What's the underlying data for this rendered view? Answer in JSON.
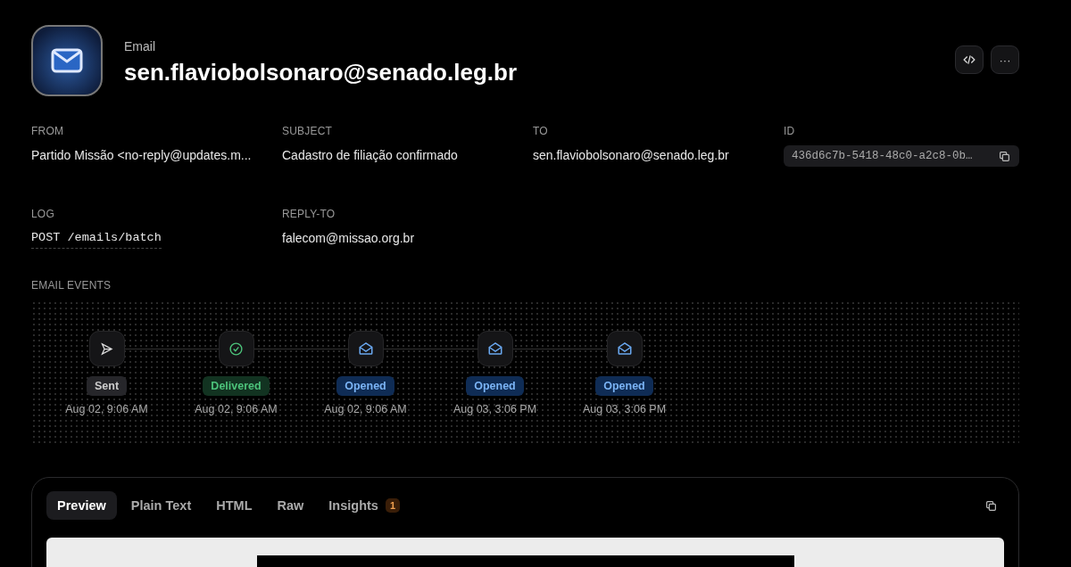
{
  "header": {
    "kind_label": "Email",
    "title": "sen.flaviobolsonaro@senado.leg.br"
  },
  "actions": [
    {
      "kind": "code"
    },
    {
      "kind": "more",
      "label": "···"
    }
  ],
  "fields": [
    {
      "label": "FROM",
      "value": "Partido Missão <no-reply@updates.m...",
      "kind": "text"
    },
    {
      "label": "SUBJECT",
      "value": "Cadastro de filiação confirmado",
      "kind": "text"
    },
    {
      "label": "TO",
      "value": "sen.flaviobolsonaro@senado.leg.br",
      "kind": "text"
    },
    {
      "label": "ID",
      "value": "436d6c7b-5418-48c0-a2c8-0b…",
      "kind": "id"
    },
    {
      "label": "LOG",
      "value": "POST /emails/batch",
      "kind": "log"
    },
    {
      "label": "REPLY-TO",
      "value": "falecom@missao.org.br",
      "kind": "text"
    }
  ],
  "events": {
    "label": "EMAIL EVENTS",
    "items": [
      {
        "kind": "sent",
        "status": "Sent",
        "time": "Aug 02, 9:06 AM"
      },
      {
        "kind": "delivered",
        "status": "Delivered",
        "time": "Aug 02, 9:06 AM"
      },
      {
        "kind": "opened",
        "status": "Opened",
        "time": "Aug 02, 9:06 AM"
      },
      {
        "kind": "opened",
        "status": "Opened",
        "time": "Aug 03, 3:06 PM"
      },
      {
        "kind": "opened",
        "status": "Opened",
        "time": "Aug 03, 3:06 PM"
      }
    ]
  },
  "preview": {
    "tabs": [
      {
        "label": "Preview",
        "selected": true
      },
      {
        "label": "Plain Text",
        "selected": false
      },
      {
        "label": "HTML",
        "selected": false
      },
      {
        "label": "Raw",
        "selected": false
      },
      {
        "label": "Insights",
        "selected": false,
        "count": "1"
      }
    ]
  }
}
